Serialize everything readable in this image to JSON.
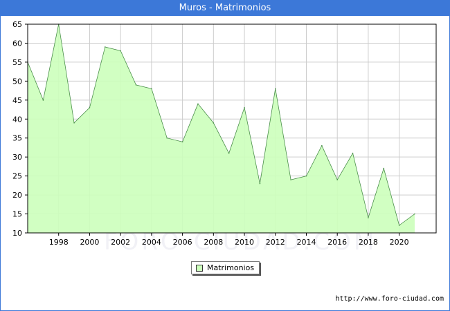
{
  "header": {
    "title": "Muros - Matrimonios"
  },
  "watermark": "FORO-CIUDAD.COM",
  "footer": {
    "source": "http://www.foro-ciudad.com"
  },
  "colors": {
    "title_bar": "#3c78d8",
    "area_fill": "#ccffbb",
    "line": "#4a8f4a",
    "grid": "#cccccc"
  },
  "chart_data": {
    "type": "area",
    "title": "Muros - Matrimonios",
    "xlabel": "",
    "ylabel": "",
    "xlim": [
      1996,
      2021
    ],
    "ylim": [
      10,
      65
    ],
    "grid": true,
    "legend_position": "bottom-center",
    "x_ticks": [
      1998,
      2000,
      2002,
      2004,
      2006,
      2008,
      2010,
      2012,
      2014,
      2016,
      2018,
      2020
    ],
    "y_ticks": [
      10,
      15,
      20,
      25,
      30,
      35,
      40,
      45,
      50,
      55,
      60,
      65
    ],
    "series": [
      {
        "name": "Matrimonios",
        "x": [
          1996,
          1997,
          1998,
          1999,
          2000,
          2001,
          2002,
          2003,
          2004,
          2005,
          2006,
          2007,
          2008,
          2009,
          2010,
          2011,
          2012,
          2013,
          2014,
          2015,
          2016,
          2017,
          2018,
          2019,
          2020,
          2021
        ],
        "values": [
          55,
          45,
          65,
          39,
          43,
          59,
          58,
          49,
          48,
          35,
          34,
          44,
          39,
          31,
          43,
          23,
          48,
          24,
          25,
          33,
          24,
          31,
          14,
          27,
          12,
          15
        ]
      }
    ]
  }
}
